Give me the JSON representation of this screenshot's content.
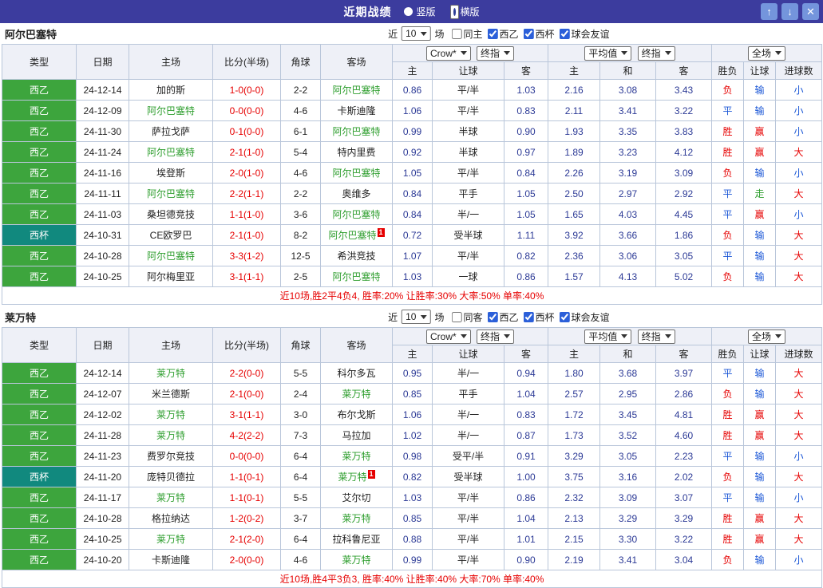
{
  "topbar": {
    "title": "近期战绩",
    "layout_options": [
      {
        "label": "竖版",
        "selected": false
      },
      {
        "label": "横版",
        "selected": true
      }
    ],
    "buttons": {
      "up": "↑",
      "down": "↓",
      "close": "✕"
    }
  },
  "filter": {
    "near": "近",
    "count": "10",
    "games": "场"
  },
  "header": {
    "type": "类型",
    "date": "日期",
    "home": "主场",
    "score": "比分(半场)",
    "corner": "角球",
    "away": "客场",
    "bookmaker": "Crow*",
    "final1": "终指",
    "average": "平均值",
    "final2": "终指",
    "full": "全场",
    "h_home": "主",
    "h_handicap": "让球",
    "h_away": "客",
    "a_home": "主",
    "a_draw": "和",
    "a_away": "客",
    "r_wdl": "胜负",
    "r_handicap": "让球",
    "r_goals": "进球数"
  },
  "colors": {
    "topbar_bg": "#3c3c9e",
    "league_liga": "#3da53d",
    "league_cup": "#11897e",
    "subject_green": "#2e9e2e",
    "score_red": "#e60000",
    "odds_navy": "#2c3a96",
    "result_red": "#e60000",
    "result_blue": "#1a56d6",
    "result_green": "#2e9e2e"
  },
  "sections": [
    {
      "team": "阿尔巴塞特",
      "checkboxes": [
        {
          "label": "同主",
          "checked": false
        },
        {
          "label": "西乙",
          "checked": true
        },
        {
          "label": "西杯",
          "checked": true
        },
        {
          "label": "球会友谊",
          "checked": true
        }
      ],
      "rows": [
        {
          "league": "西乙",
          "date": "24-12-14",
          "home": "加的斯",
          "home_subject": false,
          "home_badge": "",
          "score": "1-0(0-0)",
          "corner": "2-2",
          "away": "阿尔巴塞特",
          "away_subject": true,
          "away_badge": "",
          "odds": [
            "0.86",
            "平/半",
            "1.03"
          ],
          "avg": [
            "2.16",
            "3.08",
            "3.43"
          ],
          "results": [
            {
              "t": "负",
              "c": "red"
            },
            {
              "t": "输",
              "c": "blue"
            },
            {
              "t": "小",
              "c": "blue"
            }
          ]
        },
        {
          "league": "西乙",
          "date": "24-12-09",
          "home": "阿尔巴塞特",
          "home_subject": true,
          "home_badge": "",
          "score": "0-0(0-0)",
          "corner": "4-6",
          "away": "卡斯迪隆",
          "away_subject": false,
          "away_badge": "",
          "odds": [
            "1.06",
            "平/半",
            "0.83"
          ],
          "avg": [
            "2.11",
            "3.41",
            "3.22"
          ],
          "results": [
            {
              "t": "平",
              "c": "blue"
            },
            {
              "t": "输",
              "c": "blue"
            },
            {
              "t": "小",
              "c": "blue"
            }
          ]
        },
        {
          "league": "西乙",
          "date": "24-11-30",
          "home": "萨拉戈萨",
          "home_subject": false,
          "home_badge": "",
          "score": "0-1(0-0)",
          "corner": "6-1",
          "away": "阿尔巴塞特",
          "away_subject": true,
          "away_badge": "",
          "odds": [
            "0.99",
            "半球",
            "0.90"
          ],
          "avg": [
            "1.93",
            "3.35",
            "3.83"
          ],
          "results": [
            {
              "t": "胜",
              "c": "red"
            },
            {
              "t": "赢",
              "c": "red"
            },
            {
              "t": "小",
              "c": "blue"
            }
          ]
        },
        {
          "league": "西乙",
          "date": "24-11-24",
          "home": "阿尔巴塞特",
          "home_subject": true,
          "home_badge": "",
          "score": "2-1(1-0)",
          "corner": "5-4",
          "away": "特内里费",
          "away_subject": false,
          "away_badge": "",
          "odds": [
            "0.92",
            "半球",
            "0.97"
          ],
          "avg": [
            "1.89",
            "3.23",
            "4.12"
          ],
          "results": [
            {
              "t": "胜",
              "c": "red"
            },
            {
              "t": "赢",
              "c": "red"
            },
            {
              "t": "大",
              "c": "red"
            }
          ]
        },
        {
          "league": "西乙",
          "date": "24-11-16",
          "home": "埃登斯",
          "home_subject": false,
          "home_badge": "",
          "score": "2-0(1-0)",
          "corner": "4-6",
          "away": "阿尔巴塞特",
          "away_subject": true,
          "away_badge": "",
          "odds": [
            "1.05",
            "平/半",
            "0.84"
          ],
          "avg": [
            "2.26",
            "3.19",
            "3.09"
          ],
          "results": [
            {
              "t": "负",
              "c": "red"
            },
            {
              "t": "输",
              "c": "blue"
            },
            {
              "t": "小",
              "c": "blue"
            }
          ]
        },
        {
          "league": "西乙",
          "date": "24-11-11",
          "home": "阿尔巴塞特",
          "home_subject": true,
          "home_badge": "",
          "score": "2-2(1-1)",
          "corner": "2-2",
          "away": "奥维多",
          "away_subject": false,
          "away_badge": "",
          "odds": [
            "0.84",
            "平手",
            "1.05"
          ],
          "avg": [
            "2.50",
            "2.97",
            "2.92"
          ],
          "results": [
            {
              "t": "平",
              "c": "blue"
            },
            {
              "t": "走",
              "c": "green"
            },
            {
              "t": "大",
              "c": "red"
            }
          ]
        },
        {
          "league": "西乙",
          "date": "24-11-03",
          "home": "桑坦德竞技",
          "home_subject": false,
          "home_badge": "",
          "score": "1-1(1-0)",
          "corner": "3-6",
          "away": "阿尔巴塞特",
          "away_subject": true,
          "away_badge": "",
          "odds": [
            "0.84",
            "半/一",
            "1.05"
          ],
          "avg": [
            "1.65",
            "4.03",
            "4.45"
          ],
          "results": [
            {
              "t": "平",
              "c": "blue"
            },
            {
              "t": "赢",
              "c": "red"
            },
            {
              "t": "小",
              "c": "blue"
            }
          ]
        },
        {
          "league": "西杯",
          "date": "24-10-31",
          "home": "CE欧罗巴",
          "home_subject": false,
          "home_badge": "",
          "score": "2-1(1-0)",
          "corner": "8-2",
          "away": "阿尔巴塞特",
          "away_subject": true,
          "away_badge": "1",
          "odds": [
            "0.72",
            "受半球",
            "1.11"
          ],
          "avg": [
            "3.92",
            "3.66",
            "1.86"
          ],
          "results": [
            {
              "t": "负",
              "c": "red"
            },
            {
              "t": "输",
              "c": "blue"
            },
            {
              "t": "大",
              "c": "red"
            }
          ]
        },
        {
          "league": "西乙",
          "date": "24-10-28",
          "home": "阿尔巴塞特",
          "home_subject": true,
          "home_badge": "",
          "score": "3-3(1-2)",
          "corner": "12-5",
          "away": "希洪竞技",
          "away_subject": false,
          "away_badge": "",
          "odds": [
            "1.07",
            "平/半",
            "0.82"
          ],
          "avg": [
            "2.36",
            "3.06",
            "3.05"
          ],
          "results": [
            {
              "t": "平",
              "c": "blue"
            },
            {
              "t": "输",
              "c": "blue"
            },
            {
              "t": "大",
              "c": "red"
            }
          ]
        },
        {
          "league": "西乙",
          "date": "24-10-25",
          "home": "阿尔梅里亚",
          "home_subject": false,
          "home_badge": "",
          "score": "3-1(1-1)",
          "corner": "2-5",
          "away": "阿尔巴塞特",
          "away_subject": true,
          "away_badge": "",
          "odds": [
            "1.03",
            "一球",
            "0.86"
          ],
          "avg": [
            "1.57",
            "4.13",
            "5.02"
          ],
          "results": [
            {
              "t": "负",
              "c": "red"
            },
            {
              "t": "输",
              "c": "blue"
            },
            {
              "t": "大",
              "c": "red"
            }
          ]
        }
      ],
      "summary": "近10场,胜2平4负4, 胜率:20% 让胜率:30% 大率:50% 单率:40%"
    },
    {
      "team": "莱万特",
      "checkboxes": [
        {
          "label": "同客",
          "checked": false
        },
        {
          "label": "西乙",
          "checked": true
        },
        {
          "label": "西杯",
          "checked": true
        },
        {
          "label": "球会友谊",
          "checked": true
        }
      ],
      "rows": [
        {
          "league": "西乙",
          "date": "24-12-14",
          "home": "莱万特",
          "home_subject": true,
          "home_badge": "",
          "score": "2-2(0-0)",
          "corner": "5-5",
          "away": "科尔多瓦",
          "away_subject": false,
          "away_badge": "",
          "odds": [
            "0.95",
            "半/一",
            "0.94"
          ],
          "avg": [
            "1.80",
            "3.68",
            "3.97"
          ],
          "results": [
            {
              "t": "平",
              "c": "blue"
            },
            {
              "t": "输",
              "c": "blue"
            },
            {
              "t": "大",
              "c": "red"
            }
          ]
        },
        {
          "league": "西乙",
          "date": "24-12-07",
          "home": "米兰德斯",
          "home_subject": false,
          "home_badge": "",
          "score": "2-1(0-0)",
          "corner": "2-4",
          "away": "莱万特",
          "away_subject": true,
          "away_badge": "",
          "odds": [
            "0.85",
            "平手",
            "1.04"
          ],
          "avg": [
            "2.57",
            "2.95",
            "2.86"
          ],
          "results": [
            {
              "t": "负",
              "c": "red"
            },
            {
              "t": "输",
              "c": "blue"
            },
            {
              "t": "大",
              "c": "red"
            }
          ]
        },
        {
          "league": "西乙",
          "date": "24-12-02",
          "home": "莱万特",
          "home_subject": true,
          "home_badge": "",
          "score": "3-1(1-1)",
          "corner": "3-0",
          "away": "布尔戈斯",
          "away_subject": false,
          "away_badge": "",
          "odds": [
            "1.06",
            "半/一",
            "0.83"
          ],
          "avg": [
            "1.72",
            "3.45",
            "4.81"
          ],
          "results": [
            {
              "t": "胜",
              "c": "red"
            },
            {
              "t": "赢",
              "c": "red"
            },
            {
              "t": "大",
              "c": "red"
            }
          ]
        },
        {
          "league": "西乙",
          "date": "24-11-28",
          "home": "莱万特",
          "home_subject": true,
          "home_badge": "",
          "score": "4-2(2-2)",
          "corner": "7-3",
          "away": "马拉加",
          "away_subject": false,
          "away_badge": "",
          "odds": [
            "1.02",
            "半/一",
            "0.87"
          ],
          "avg": [
            "1.73",
            "3.52",
            "4.60"
          ],
          "results": [
            {
              "t": "胜",
              "c": "red"
            },
            {
              "t": "赢",
              "c": "red"
            },
            {
              "t": "大",
              "c": "red"
            }
          ]
        },
        {
          "league": "西乙",
          "date": "24-11-23",
          "home": "费罗尔竞技",
          "home_subject": false,
          "home_badge": "",
          "score": "0-0(0-0)",
          "corner": "6-4",
          "away": "莱万特",
          "away_subject": true,
          "away_badge": "",
          "odds": [
            "0.98",
            "受平/半",
            "0.91"
          ],
          "avg": [
            "3.29",
            "3.05",
            "2.23"
          ],
          "results": [
            {
              "t": "平",
              "c": "blue"
            },
            {
              "t": "输",
              "c": "blue"
            },
            {
              "t": "小",
              "c": "blue"
            }
          ]
        },
        {
          "league": "西杯",
          "date": "24-11-20",
          "home": "庞特贝德拉",
          "home_subject": false,
          "home_badge": "",
          "score": "1-1(0-1)",
          "corner": "6-4",
          "away": "莱万特",
          "away_subject": true,
          "away_badge": "1",
          "odds": [
            "0.82",
            "受半球",
            "1.00"
          ],
          "avg": [
            "3.75",
            "3.16",
            "2.02"
          ],
          "results": [
            {
              "t": "负",
              "c": "red"
            },
            {
              "t": "输",
              "c": "blue"
            },
            {
              "t": "大",
              "c": "red"
            }
          ]
        },
        {
          "league": "西乙",
          "date": "24-11-17",
          "home": "莱万特",
          "home_subject": true,
          "home_badge": "",
          "score": "1-1(0-1)",
          "corner": "5-5",
          "away": "艾尔切",
          "away_subject": false,
          "away_badge": "",
          "odds": [
            "1.03",
            "平/半",
            "0.86"
          ],
          "avg": [
            "2.32",
            "3.09",
            "3.07"
          ],
          "results": [
            {
              "t": "平",
              "c": "blue"
            },
            {
              "t": "输",
              "c": "blue"
            },
            {
              "t": "小",
              "c": "blue"
            }
          ]
        },
        {
          "league": "西乙",
          "date": "24-10-28",
          "home": "格拉纳达",
          "home_subject": false,
          "home_badge": "",
          "score": "1-2(0-2)",
          "corner": "3-7",
          "away": "莱万特",
          "away_subject": true,
          "away_badge": "",
          "odds": [
            "0.85",
            "平/半",
            "1.04"
          ],
          "avg": [
            "2.13",
            "3.29",
            "3.29"
          ],
          "results": [
            {
              "t": "胜",
              "c": "red"
            },
            {
              "t": "赢",
              "c": "red"
            },
            {
              "t": "大",
              "c": "red"
            }
          ]
        },
        {
          "league": "西乙",
          "date": "24-10-25",
          "home": "莱万特",
          "home_subject": true,
          "home_badge": "",
          "score": "2-1(2-0)",
          "corner": "6-4",
          "away": "拉科鲁尼亚",
          "away_subject": false,
          "away_badge": "",
          "odds": [
            "0.88",
            "平/半",
            "1.01"
          ],
          "avg": [
            "2.15",
            "3.30",
            "3.22"
          ],
          "results": [
            {
              "t": "胜",
              "c": "red"
            },
            {
              "t": "赢",
              "c": "red"
            },
            {
              "t": "大",
              "c": "red"
            }
          ]
        },
        {
          "league": "西乙",
          "date": "24-10-20",
          "home": "卡斯迪隆",
          "home_subject": false,
          "home_badge": "",
          "score": "2-0(0-0)",
          "corner": "4-6",
          "away": "莱万特",
          "away_subject": true,
          "away_badge": "",
          "odds": [
            "0.99",
            "平/半",
            "0.90"
          ],
          "avg": [
            "2.19",
            "3.41",
            "3.04"
          ],
          "results": [
            {
              "t": "负",
              "c": "red"
            },
            {
              "t": "输",
              "c": "blue"
            },
            {
              "t": "小",
              "c": "blue"
            }
          ]
        }
      ],
      "summary": "近10场,胜4平3负3, 胜率:40% 让胜率:40% 大率:70% 单率:40%"
    }
  ]
}
